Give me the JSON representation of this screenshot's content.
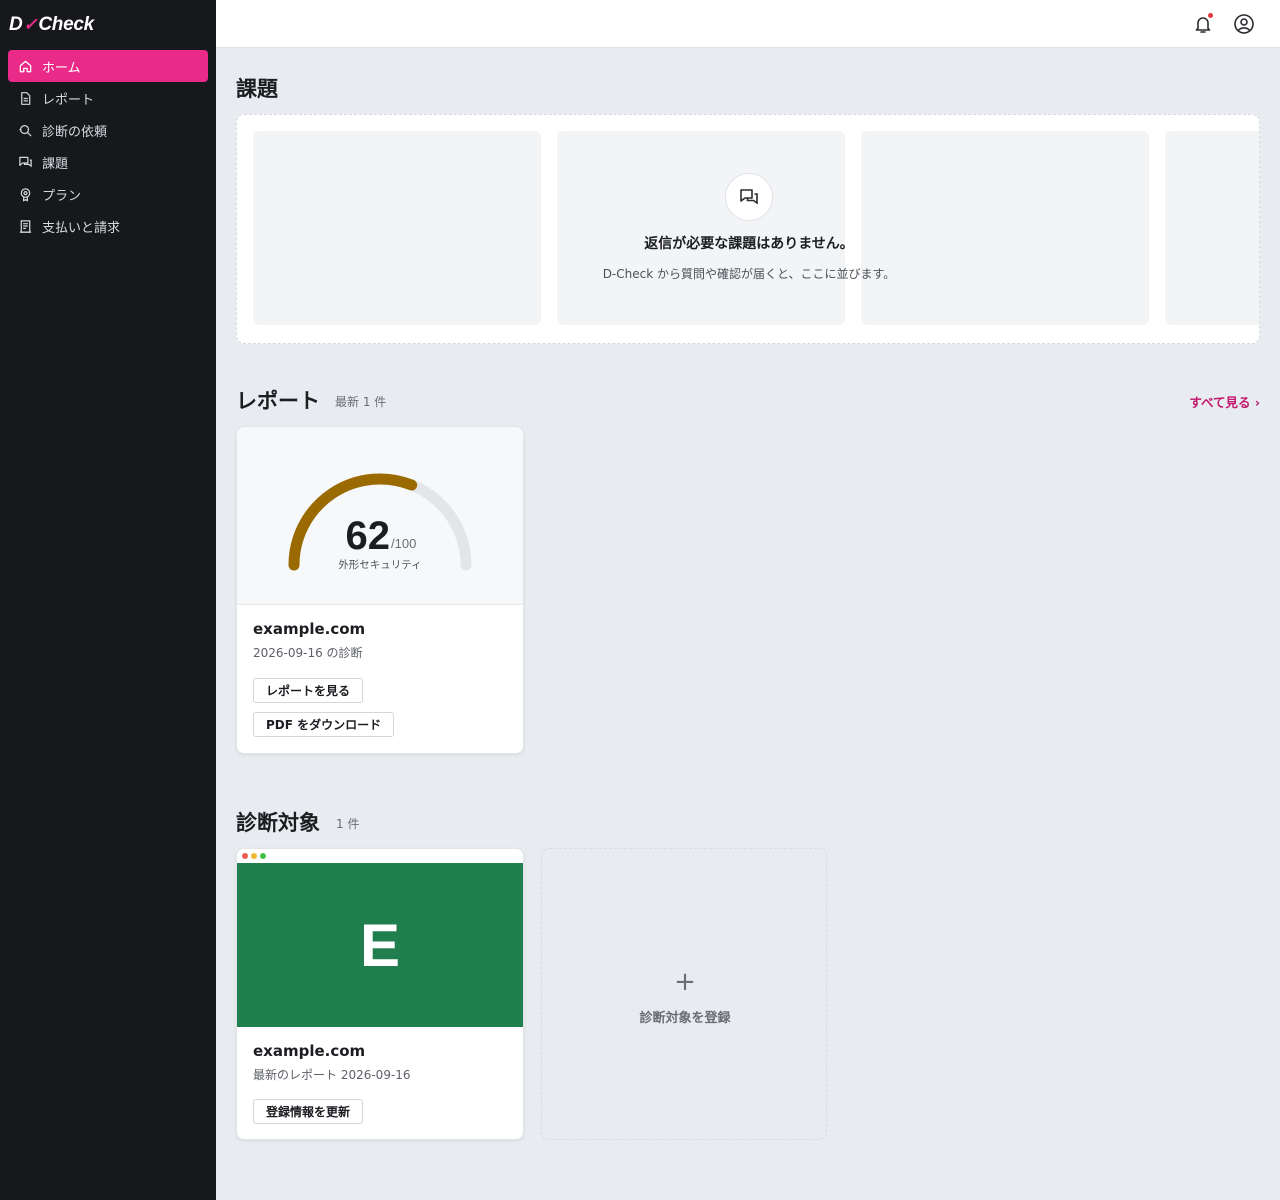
{
  "app": {
    "logo_d": "D",
    "logo_check": "Check"
  },
  "sidebar": {
    "items": [
      {
        "label": "ホーム",
        "icon": "home-icon",
        "active": true
      },
      {
        "label": "レポート",
        "icon": "document-icon",
        "active": false
      },
      {
        "label": "診断の依頼",
        "icon": "search-scan-icon",
        "active": false
      },
      {
        "label": "課題",
        "icon": "chat-icon",
        "active": false
      },
      {
        "label": "プラン",
        "icon": "badge-icon",
        "active": false
      },
      {
        "label": "支払いと請求",
        "icon": "receipt-icon",
        "active": false
      }
    ]
  },
  "header": {
    "notification_icon": "bell-icon",
    "account_icon": "user-circle-icon"
  },
  "issues": {
    "title": "課題",
    "empty_title": "返信が必要な課題はありません。",
    "empty_desc": "D-Check から質問や確認が届くと、ここに並びます。"
  },
  "reports": {
    "title": "レポート",
    "subtitle": "最新 1 件",
    "see_all": "すべて見る ›",
    "card": {
      "score": "62",
      "score_max": "/100",
      "score_value": 62,
      "score_total": 100,
      "score_label": "外形セキュリティ",
      "domain": "example.com",
      "meta": "2026-09-16 の診断",
      "view_btn": "レポートを見る",
      "pdf_btn": "PDF をダウンロード"
    }
  },
  "targets": {
    "title": "診断対象",
    "subtitle": "1 件",
    "card": {
      "initial": "E",
      "domain": "example.com",
      "meta": "最新のレポート 2026-09-16",
      "update_btn": "登録情報を更新"
    },
    "add_plus": "+",
    "add_label": "診断対象を登録"
  },
  "colors": {
    "accent": "#ea2a88",
    "link": "#c2186f",
    "gauge": "#9a6a00",
    "thumb": "#207e4f"
  }
}
